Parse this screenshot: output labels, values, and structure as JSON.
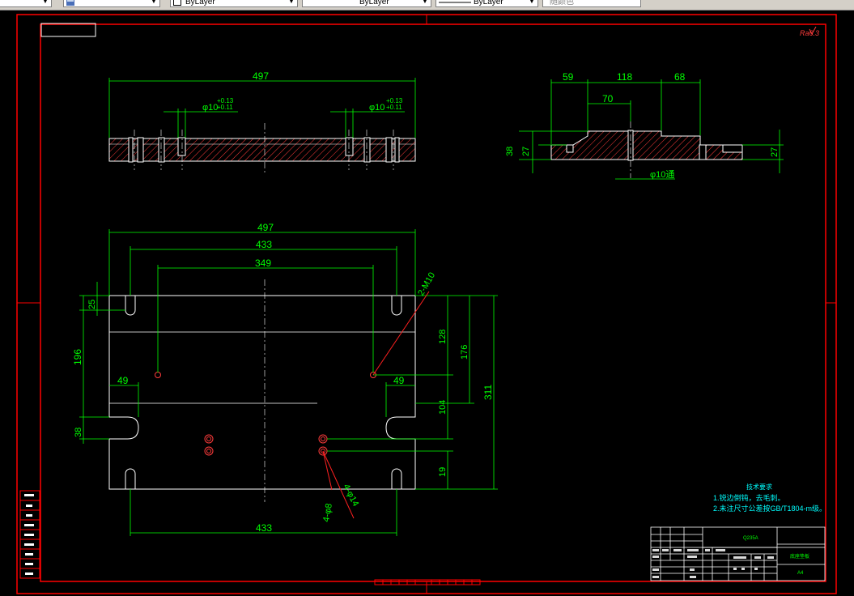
{
  "toolbar": {
    "layer_combo": "",
    "color_combo": "ByLayer",
    "linetype_combo": "ByLayer",
    "lineweight_combo": "ByLayer",
    "plotstyle_combo": "随颜色"
  },
  "drawing": {
    "colors": {
      "background": "#000000",
      "frame": "#ff0000",
      "outline": "#ffffff",
      "dimension": "#00ff00",
      "section_hatch": "#ff3b3b",
      "leader": "#ff2020"
    },
    "dims_top": [
      "497",
      "φ10",
      "+0.13",
      "+0.11",
      "φ10",
      "+0.13",
      "+0.11"
    ],
    "dims_right": [
      "59",
      "118",
      "68",
      "70",
      "38",
      "27",
      "27",
      "φ10通"
    ],
    "dims_plan": [
      "497",
      "433",
      "349",
      "2-M10",
      "25",
      "196",
      "49",
      "49",
      "128",
      "176",
      "311",
      "104",
      "38",
      "19",
      "4-φ8",
      "4-φ14",
      "433"
    ],
    "roughness_mark": "Ra6.3",
    "tech_requirements": {
      "title": "技术要求",
      "line1": "1.锐边倒钝，去毛刺。",
      "line2": "2.未注尺寸公差按GB/T1804-m级。"
    },
    "title_block": {
      "material": "Q235A",
      "part_name": "底座垫板",
      "sheet_size": "A4"
    }
  }
}
